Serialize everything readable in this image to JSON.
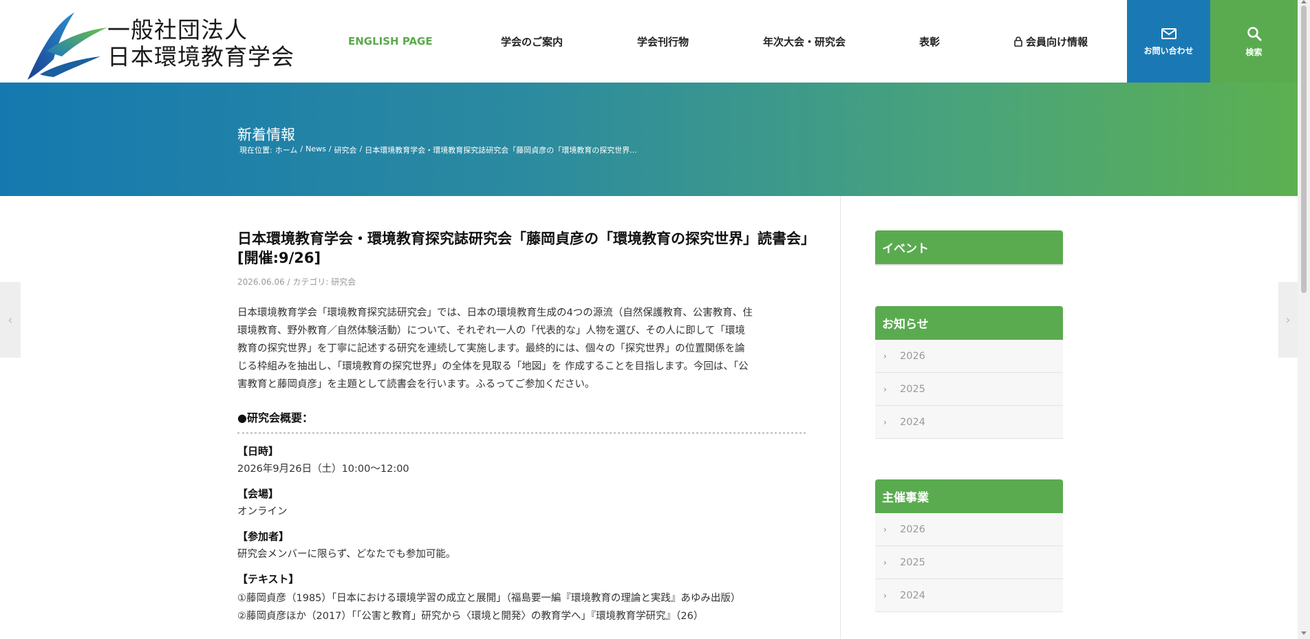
{
  "logo": {
    "line1": "一般社団法人",
    "line2": "日本環境教育学会"
  },
  "nav": {
    "items": [
      {
        "label": "ENGLISH PAGE"
      },
      {
        "label": "学会のご案内"
      },
      {
        "label": "学会刊行物"
      },
      {
        "label": "年次大会・研究会"
      },
      {
        "label": "表彰"
      },
      {
        "label": "会員向け情報"
      }
    ],
    "contact_label": "お問い合わせ",
    "search_label": "検索"
  },
  "hero": {
    "title": "新着情報",
    "breadcrumb": {
      "prefix": "現在位置:",
      "home": "ホーム",
      "news": "News",
      "category": "研究会",
      "current": "日本環境教育学会・環境教育探究誌研究会「藤岡貞彦の「環境教育の探究世界..."
    }
  },
  "article": {
    "title": "日本環境教育学会・環境教育探究誌研究会「藤岡貞彦の「環境教育の探究世界」読書会」[開催:9/26]",
    "date": "2026.06.06",
    "category": "カテゴリ: 研究会",
    "body_lines": [
      "日本環境教育学会「環境教育探究誌研究会」では、日本の環境教育生成の4つの源流（自然保護教育、公害教育、住",
      "環境教育、野外教育／自然体験活動）について、それぞれ一人の「代表的な」人物を選び、その人に即して「環境",
      "教育の探究世界」を丁寧に記述する研究を連続して実施します。最終的には、個々の「探究世界」の位置関係を論",
      "じる枠組みを抽出し、「環境教育の探究世界」の全体を見取る「地図」を 作成することを目指します。今回は、「公",
      "害教育と藤岡貞彦」を主題として読書会を行います。ふるってご参加ください。"
    ],
    "overview_heading": "●研究会概要：",
    "datetime_label": "【日時】",
    "datetime_value": "2026年9月26日（土）10:00〜12:00",
    "venue_label": "【会場】",
    "venue_value": "オンライン",
    "participants_label": "【参加者】",
    "participants_value": "研究会メンバーに限らず、どなたでも参加可能。",
    "text_label": "【テキスト】",
    "texts": [
      "①藤岡貞彦（1985）「日本における環境学習の成立と展開」（福島要一編『環境教育の理論と実践』あゆみ出版）",
      "②藤岡貞彦ほか（2017）「「公害と教育」研究から〈環境と開発〉の教育学へ」『環境教育学研究』（26）"
    ]
  },
  "sidebar": {
    "event": {
      "title": "イベント"
    },
    "news": {
      "title": "お知らせ",
      "items": [
        "2026",
        "2025",
        "2024"
      ]
    },
    "sponsored": {
      "title": "主催事業",
      "items": [
        "2026",
        "2025",
        "2024"
      ]
    }
  },
  "colors": {
    "green": "#5aab4f",
    "blue": "#1a79b5"
  }
}
